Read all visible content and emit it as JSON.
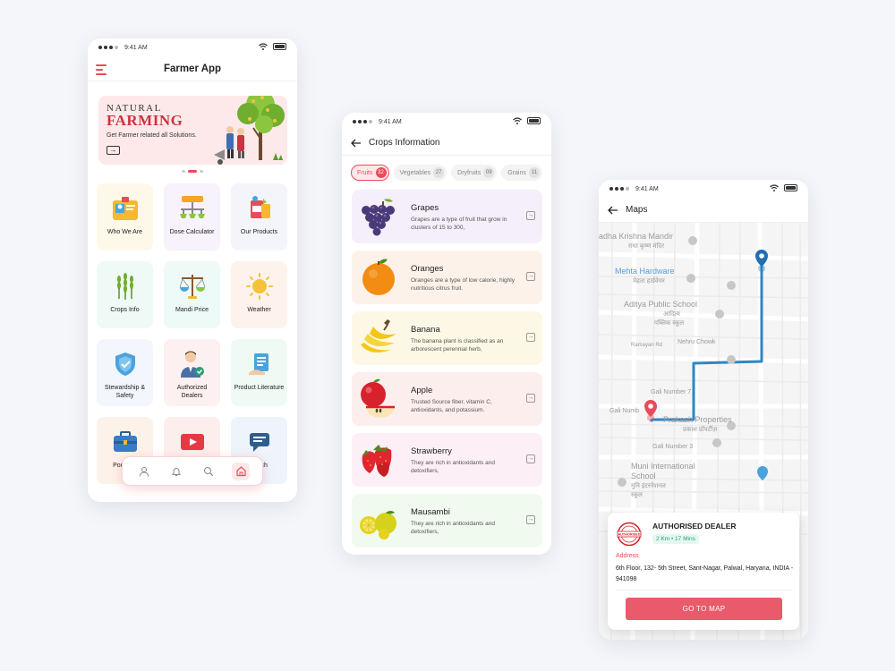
{
  "status": {
    "time": "9:41 AM"
  },
  "home": {
    "title": "Farmer App",
    "banner": {
      "kicker": "NATURAL",
      "headline": "FARMING",
      "subtitle": "Get Farmer related all Solutions."
    },
    "tiles": [
      {
        "label": "Who We Are",
        "bg": "#fdf8e8"
      },
      {
        "label": "Dose Calculator",
        "bg": "#f7f2fb"
      },
      {
        "label": "Our Products",
        "bg": "#f3f5fb"
      },
      {
        "label": "Crops Info",
        "bg": "#effaf6"
      },
      {
        "label": "Mandi Price",
        "bg": "#eefaf8"
      },
      {
        "label": "Weather",
        "bg": "#fdf3ec"
      },
      {
        "label": "Stewardship & Safety",
        "bg": "#f3f6fd"
      },
      {
        "label": "Authorized Dealers",
        "bg": "#fdf0f0"
      },
      {
        "label": "Product Literature",
        "bg": "#effaf5"
      },
      {
        "label": "Por Solu",
        "bg": "#fdf2ea"
      },
      {
        "label": "",
        "bg": "#fdeeee"
      },
      {
        "label": "Touch",
        "bg": "#eef4fb"
      }
    ]
  },
  "crops": {
    "title": "Crops Information",
    "chips": [
      {
        "label": "Fruits",
        "count": "32",
        "active": true
      },
      {
        "label": "Vegetables",
        "count": "27",
        "active": false
      },
      {
        "label": "Dryfruits",
        "count": "09",
        "active": false
      },
      {
        "label": "Grains",
        "count": "11",
        "active": false
      }
    ],
    "items": [
      {
        "name": "Grapes",
        "desc": "Grapes are a type of fruit that grow in clusters of 15 to 300,",
        "bg": "#f4effa"
      },
      {
        "name": "Oranges",
        "desc": "Oranges are a type of low calorie, highly nutritious citrus fruit.",
        "bg": "#fdf2ea"
      },
      {
        "name": "Banana",
        "desc": "The banana plant is classified as an arborescent perennial herb,",
        "bg": "#fdf8e6"
      },
      {
        "name": "Apple",
        "desc": "Trusted Source fiber, vitamin C, antioxidants, and potassium.",
        "bg": "#fdeeee"
      },
      {
        "name": "Strawberry",
        "desc": "They are rich in antioxidants and detoxifiers,",
        "bg": "#fcf0f6"
      },
      {
        "name": "Mausambi",
        "desc": "They are rich in antioxidants and detoxifiers,",
        "bg": "#f1faee"
      }
    ]
  },
  "maps": {
    "title": "Maps",
    "places": [
      "adha Krishna Mandir",
      "राधा कृष्ण मंदिर",
      "Mehta Hardware",
      "मेहता हार्डवेयर",
      "Aditya Public School",
      "आदित्य",
      "पब्लिक स्कूल",
      "Ramayan Rd",
      "Nehru Chowk",
      "Gali Number 7",
      "Gali Numb",
      "Prakash Properties",
      "प्रकाश प्रॉपर्टीज़",
      "Gali Number 3",
      "Muni International",
      "School",
      "मुनि इंटरनेशनल",
      "स्कूल"
    ],
    "dealer": {
      "title": "AUTHORISED DEALER",
      "meta": "2 Km • 17 Mins",
      "address_label": "Address",
      "address": "6th Floor, 132- 5th Street, Sant-Nagar, Palwal, Haryana, INDIA - 941098",
      "button": "GO TO MAP",
      "seal_text": "AUTHORISED"
    }
  },
  "colors": {
    "accent": "#e84c5a",
    "route": "#2f86c6"
  }
}
